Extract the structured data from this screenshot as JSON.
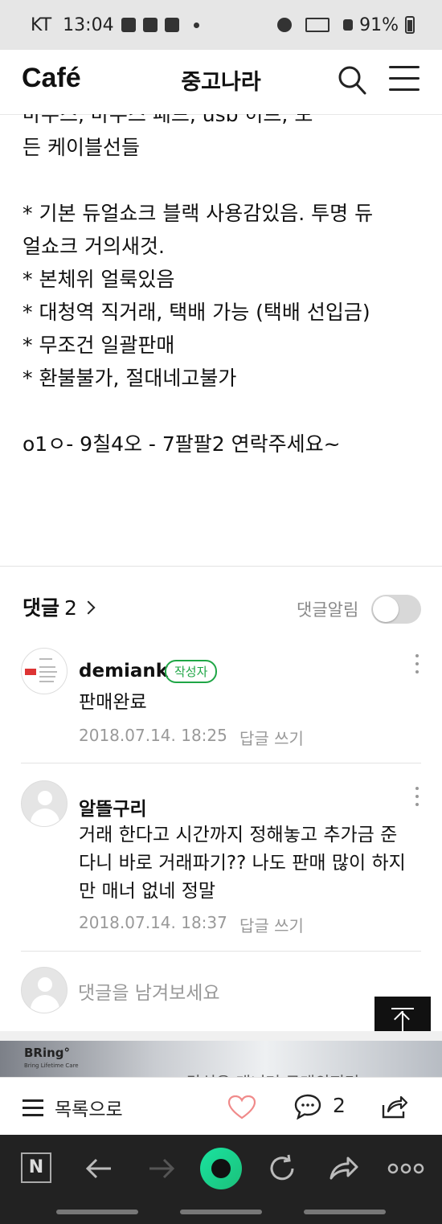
{
  "status_bar": {
    "carrier": "KT",
    "time": "13:04",
    "battery": "91%"
  },
  "header": {
    "logo": "Café",
    "title": "중고나라"
  },
  "article": {
    "cut_line": "마우스, 마우스 패드, usb 허브, 모",
    "lines": [
      "든 케이블선들",
      "",
      "* 기본 듀얼쇼크 블랙 사용감있음. 투명 듀",
      "얼쇼크 거의새것.",
      "* 본체위 얼룩있음",
      "* 대청역 직거래, 택배 가능 (택배 선입금)",
      "* 무조건 일괄판매",
      "* 환불불가, 절대네고불가",
      "",
      "o1ㅇ- 9칠4오 - 7팔팔2 연락주세요~"
    ]
  },
  "comments_header": {
    "label": "댓글",
    "count": "2",
    "notify_label": "댓글알림",
    "notify_on": false
  },
  "comments": [
    {
      "author": "demiank",
      "badge": "작성자",
      "text": "판매완료",
      "date": "2018.07.14. 18:25",
      "reply": "답글 쓰기"
    },
    {
      "author": "알뜰구리",
      "badge": "",
      "text": "거래 한다고 시간까지 정해놓고 추가금 준다니 바로 거래파기?? 나도 판매 많이 하지만 매너 없네 정말",
      "date": "2018.07.14. 18:37",
      "reply": "답글 쓰기"
    }
  ],
  "comment_input": {
    "placeholder": "댓글을 남겨보세요"
  },
  "ad": {
    "brand": "BRing°",
    "tagline": "Bring Lifetime Care",
    "cut_text": "당신은 매너며 구매의지민"
  },
  "action_bar": {
    "list_label": "목록으로",
    "comment_count": "2"
  },
  "icons": [
    "search-icon",
    "menu-icon",
    "chevron-right-icon",
    "heart-icon",
    "comment-icon",
    "share-icon",
    "scroll-top-icon",
    "back-icon",
    "forward-icon",
    "refresh-icon",
    "more-icon"
  ],
  "colors": {
    "badge_green": "#1fa646",
    "heart_pink": "#f08a8a",
    "nav_bg": "#222222"
  }
}
